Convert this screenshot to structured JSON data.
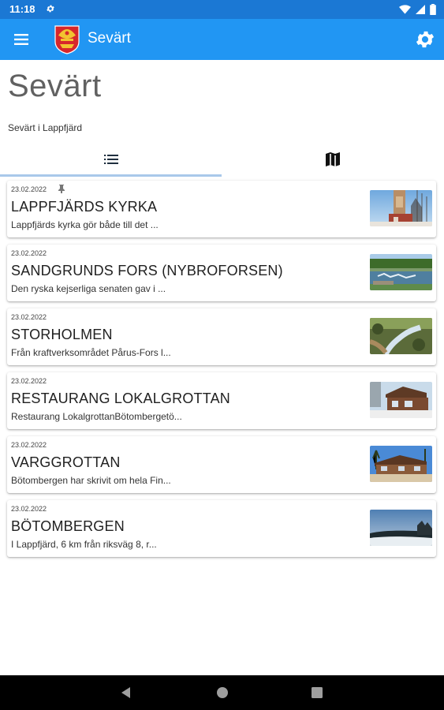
{
  "status_bar": {
    "time": "11:18",
    "icons": [
      "settings-icon",
      "wifi-icon",
      "signal-icon",
      "battery-icon"
    ]
  },
  "app_bar": {
    "title": "Sevärt",
    "icons": [
      "menu-icon",
      "coat-of-arms-logo",
      "settings-icon"
    ]
  },
  "page": {
    "title": "Sevärt",
    "subtitle": "Sevärt i Lappfjärd"
  },
  "tabs": [
    {
      "icon": "list-icon",
      "selected": true
    },
    {
      "icon": "map-icon",
      "selected": false
    }
  ],
  "colors": {
    "status_bar": "#1b78d4",
    "app_bar": "#2196f3",
    "tab_indicator": "#a9c8ea",
    "title_grey": "#616161"
  },
  "items": [
    {
      "date": "23.02.2022",
      "pinned": true,
      "title": "LAPPFJÄRDS KYRKA",
      "excerpt": "Lappfjärds kyrka gör både till det ..."
    },
    {
      "date": "23.02.2022",
      "pinned": false,
      "title": "SANDGRUNDS FORS (NYBROFORSEN)",
      "excerpt": "Den ryska kejserliga senaten gav i ..."
    },
    {
      "date": "23.02.2022",
      "pinned": false,
      "title": "STORHOLMEN",
      "excerpt": "Från kraftverksområdet Pårus-Fors l..."
    },
    {
      "date": "23.02.2022",
      "pinned": false,
      "title": "RESTAURANG LOKALGROTTAN",
      "excerpt": "Restaurang LokalgrottanBötombergetö..."
    },
    {
      "date": "23.02.2022",
      "pinned": false,
      "title": "VARGGROTTAN",
      "excerpt": "Bötombergen har skrivit om hela Fin..."
    },
    {
      "date": "23.02.2022",
      "pinned": false,
      "title": "BÖTOMBERGEN",
      "excerpt": "I Lappfjärd, 6 km från riksväg 8, r..."
    }
  ],
  "nav_bar": {
    "icons": [
      "back-icon",
      "home-icon",
      "recents-icon"
    ]
  }
}
